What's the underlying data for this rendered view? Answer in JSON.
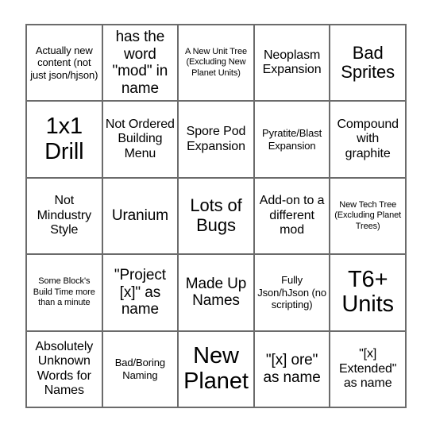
{
  "card": {
    "type": "bingo-card",
    "columns": 5,
    "rows": 5,
    "background_color": "#ffffff",
    "border_color": "#6b6b6b",
    "text_color": "#000000",
    "cells": [
      {
        "text": "Actually new content (not just json/hjson)",
        "size": "s"
      },
      {
        "text": "has the word \"mod\" in name",
        "size": "l"
      },
      {
        "text": "A New Unit Tree (Excluding New Planet Units)",
        "size": "xs"
      },
      {
        "text": "Neoplasm Expansion",
        "size": "m"
      },
      {
        "text": "Bad Sprites",
        "size": "xl"
      },
      {
        "text": "1x1 Drill",
        "size": "xxl"
      },
      {
        "text": "Not Ordered Building Menu",
        "size": "m"
      },
      {
        "text": "Spore Pod Expansion",
        "size": "m"
      },
      {
        "text": "Pyratite/Blast Expansion",
        "size": "s"
      },
      {
        "text": "Compound with graphite",
        "size": "m"
      },
      {
        "text": "Not Mindustry Style",
        "size": "m"
      },
      {
        "text": "Uranium",
        "size": "l"
      },
      {
        "text": "Lots of Bugs",
        "size": "xl"
      },
      {
        "text": "Add-on to a different mod",
        "size": "m"
      },
      {
        "text": "New Tech Tree (Excluding Planet Trees)",
        "size": "xs"
      },
      {
        "text": "Some Block's Build Time more than a minute",
        "size": "xs"
      },
      {
        "text": "\"Project [x]\" as name",
        "size": "l"
      },
      {
        "text": "Made Up Names",
        "size": "l"
      },
      {
        "text": "Fully Json/hJson (no scripting)",
        "size": "s"
      },
      {
        "text": "T6+ Units",
        "size": "xxl"
      },
      {
        "text": "Absolutely Unknown Words for Names",
        "size": "m"
      },
      {
        "text": "Bad/Boring Naming",
        "size": "s"
      },
      {
        "text": "New Planet",
        "size": "xxl"
      },
      {
        "text": "\"[x] ore\" as name",
        "size": "l"
      },
      {
        "text": "\"[x] Extended\" as name",
        "size": "m"
      }
    ]
  }
}
